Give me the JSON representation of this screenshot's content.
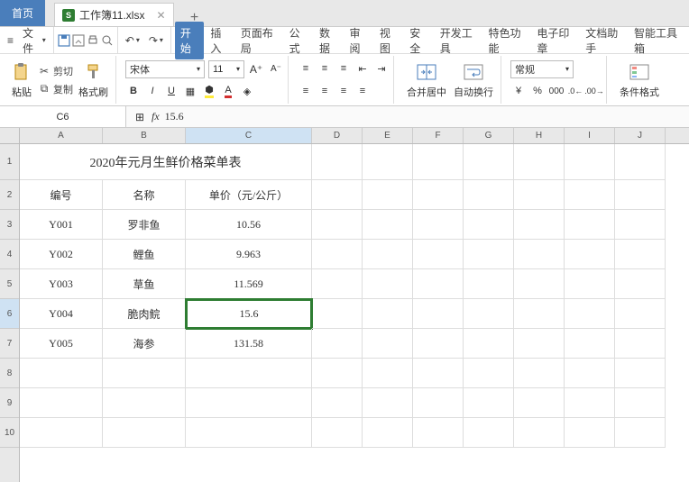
{
  "tabs": {
    "home": "首页",
    "file": "工作簿11.xlsx",
    "add": "+"
  },
  "menubar": {
    "file": "文件",
    "ribbon": [
      "开始",
      "插入",
      "页面布局",
      "公式",
      "数据",
      "审阅",
      "视图",
      "安全",
      "开发工具",
      "特色功能",
      "电子印章",
      "文档助手",
      "智能工具箱"
    ],
    "active": 0
  },
  "toolbar": {
    "paste": "粘贴",
    "cut": "剪切",
    "copy": "复制",
    "formatpainter": "格式刷",
    "font": "宋体",
    "fontsize": "11",
    "merge": "合并居中",
    "wrap": "自动换行",
    "numfmt": "常规",
    "condfmt": "条件格式"
  },
  "namebox": "C6",
  "formula": "15.6",
  "sheet": {
    "cols": [
      "A",
      "B",
      "C",
      "D",
      "E",
      "F",
      "G",
      "H",
      "I",
      "J"
    ],
    "rownums": [
      "1",
      "2",
      "3",
      "4",
      "5",
      "6",
      "7",
      "8",
      "9",
      "10"
    ],
    "title": "2020年元月生鲜价格菜单表",
    "headers": {
      "A": "编号",
      "B": "名称",
      "C": "单价（元/公斤）"
    },
    "rows": [
      {
        "A": "Y001",
        "B": "罗非鱼",
        "C": "10.56"
      },
      {
        "A": "Y002",
        "B": "鲤鱼",
        "C": "9.963"
      },
      {
        "A": "Y003",
        "B": "草鱼",
        "C": "11.569"
      },
      {
        "A": "Y004",
        "B": "脆肉鲩",
        "C": "15.6"
      },
      {
        "A": "Y005",
        "B": "海参",
        "C": "131.58"
      }
    ],
    "selected": {
      "row": 6,
      "col": "C"
    }
  },
  "chart_data": {
    "type": "table",
    "title": "2020年元月生鲜价格菜单表",
    "columns": [
      "编号",
      "名称",
      "单价（元/公斤）"
    ],
    "rows": [
      [
        "Y001",
        "罗非鱼",
        10.56
      ],
      [
        "Y002",
        "鲤鱼",
        9.963
      ],
      [
        "Y003",
        "草鱼",
        11.569
      ],
      [
        "Y004",
        "脆肉鲩",
        15.6
      ],
      [
        "Y005",
        "海参",
        131.58
      ]
    ]
  }
}
